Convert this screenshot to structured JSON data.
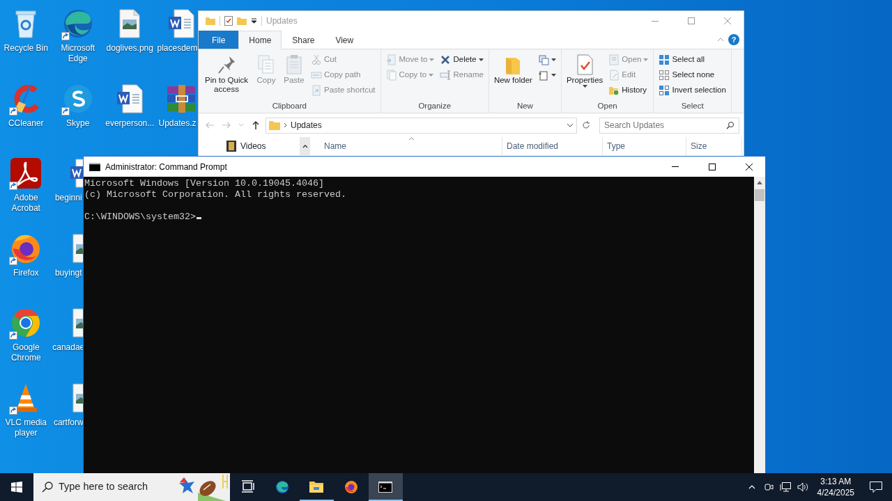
{
  "desktop": {
    "columns": [
      {
        "icons": [
          {
            "label": "Recycle Bin",
            "kind": "recycle",
            "shortcut": false
          },
          {
            "label": "CCleaner",
            "kind": "ccleaner",
            "shortcut": true
          },
          {
            "label": "Adobe Acrobat",
            "kind": "acrobat",
            "shortcut": true
          },
          {
            "label": "Firefox",
            "kind": "firefox",
            "shortcut": true
          },
          {
            "label": "Google Chrome",
            "kind": "chrome",
            "shortcut": true
          },
          {
            "label": "VLC media player",
            "kind": "vlc",
            "shortcut": true
          }
        ]
      },
      {
        "icons": [
          {
            "label": "Microsoft Edge",
            "kind": "edge",
            "shortcut": true
          },
          {
            "label": "Skype",
            "kind": "skype",
            "shortcut": true
          },
          {
            "label": "beginni",
            "kind": "word",
            "shortcut": false
          },
          {
            "label": "buyingt",
            "kind": "image",
            "shortcut": false
          },
          {
            "label": "canadae",
            "kind": "image",
            "shortcut": false
          },
          {
            "label": "cartforw",
            "kind": "image",
            "shortcut": false
          }
        ]
      },
      {
        "icons": [
          {
            "label": "doglives.png",
            "kind": "image",
            "shortcut": false
          },
          {
            "label": "everperson...",
            "kind": "word",
            "shortcut": false
          }
        ]
      },
      {
        "icons": [
          {
            "label": "placesdem",
            "kind": "word",
            "shortcut": false
          },
          {
            "label": "Updates.z",
            "kind": "winrar",
            "shortcut": false
          }
        ]
      }
    ]
  },
  "explorer": {
    "title": "Updates",
    "tabs": [
      {
        "label": "File",
        "kind": "file",
        "selected": false
      },
      {
        "label": "Home",
        "kind": "tab",
        "selected": true
      },
      {
        "label": "Share",
        "kind": "tab",
        "selected": false
      },
      {
        "label": "View",
        "kind": "tab",
        "selected": false
      }
    ],
    "help_button": "?",
    "ribbon_groups": [
      {
        "label": "Clipboard",
        "columns": [
          {
            "items": [
              {
                "label": "Pin to Quick access",
                "kind": "large",
                "disabled": false,
                "dropdown": false
              }
            ]
          },
          {
            "items": [
              {
                "label": "Copy",
                "kind": "large",
                "disabled": true,
                "dropdown": false
              }
            ]
          },
          {
            "items": [
              {
                "label": "Paste",
                "kind": "large",
                "disabled": true,
                "dropdown": false
              }
            ]
          },
          {
            "items": [
              {
                "label": "Cut",
                "kind": "small",
                "disabled": true,
                "dropdown": false
              },
              {
                "label": "Copy path",
                "kind": "small",
                "disabled": true,
                "dropdown": false
              },
              {
                "label": "Paste shortcut",
                "kind": "small",
                "disabled": true,
                "dropdown": false
              }
            ]
          }
        ]
      },
      {
        "label": "Organize",
        "columns": [
          {
            "items": [
              {
                "label": "Move to",
                "kind": "small",
                "disabled": true,
                "dropdown": true
              },
              {
                "label": "Copy to",
                "kind": "small",
                "disabled": true,
                "dropdown": true
              }
            ]
          },
          {
            "items": [
              {
                "label": "Delete",
                "kind": "small",
                "disabled": false,
                "dropdown": true
              },
              {
                "label": "Rename",
                "kind": "small",
                "disabled": true,
                "dropdown": false
              }
            ]
          }
        ]
      },
      {
        "label": "New",
        "columns": [
          {
            "items": [
              {
                "label": "New folder",
                "kind": "large",
                "disabled": false,
                "dropdown": false
              }
            ]
          },
          {
            "items": [
              {
                "kind": "icon",
                "disabled": false,
                "dropdown": true
              },
              {
                "kind": "icon",
                "disabled": false,
                "dropdown": true
              }
            ]
          }
        ]
      },
      {
        "label": "Open",
        "columns": [
          {
            "items": [
              {
                "label": "Properties",
                "kind": "large",
                "disabled": false,
                "dropdown": true
              }
            ]
          },
          {
            "items": [
              {
                "label": "Open",
                "kind": "small",
                "disabled": true,
                "dropdown": true
              },
              {
                "label": "Edit",
                "kind": "small",
                "disabled": true,
                "dropdown": false
              },
              {
                "label": "History",
                "kind": "small",
                "disabled": false,
                "dropdown": false
              }
            ]
          }
        ]
      },
      {
        "label": "Select",
        "columns": [
          {
            "items": [
              {
                "label": "Select all",
                "kind": "small",
                "disabled": false,
                "dropdown": false
              },
              {
                "label": "Select none",
                "kind": "small",
                "disabled": false,
                "dropdown": false
              },
              {
                "label": "Invert selection",
                "kind": "small",
                "disabled": false,
                "dropdown": false
              }
            ]
          }
        ]
      }
    ],
    "nav_buttons": [
      {
        "kind": "back",
        "disabled": true
      },
      {
        "kind": "forward",
        "disabled": true
      },
      {
        "kind": "recent",
        "disabled": true
      },
      {
        "kind": "up",
        "disabled": false
      }
    ],
    "address": "Updates",
    "search": {
      "placeholder": "Search Updates"
    },
    "nav_pane": [
      {
        "label": "Videos"
      }
    ],
    "columns": [
      {
        "label": "Name",
        "sorted": true
      },
      {
        "label": "Date modified",
        "sorted": false
      },
      {
        "label": "Type",
        "sorted": false
      },
      {
        "label": "Size",
        "sorted": false
      }
    ]
  },
  "cmd": {
    "title": "Administrator: Command Prompt",
    "lines": [
      "Microsoft Windows [Version 10.0.19045.4046]",
      "(c) Microsoft Corporation. All rights reserved."
    ],
    "prompt": "C:\\WINDOWS\\system32>"
  },
  "taskbar": {
    "search": {
      "placeholder": "Type here to search"
    },
    "apps": [
      {
        "kind": "taskview",
        "running": false,
        "selected": false
      },
      {
        "kind": "edge",
        "running": false,
        "selected": false
      },
      {
        "kind": "explorer",
        "running": true,
        "selected": false
      },
      {
        "kind": "firefox",
        "running": false,
        "selected": false
      },
      {
        "kind": "cmd",
        "running": true,
        "selected": true
      }
    ],
    "time": "3:13 AM",
    "date": "4/24/2025"
  }
}
